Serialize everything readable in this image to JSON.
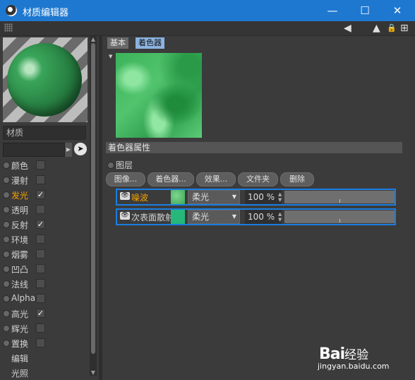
{
  "window": {
    "title": "材质编辑器",
    "minimize": "—",
    "maximize": "☐",
    "close": "✕"
  },
  "toolbar": {
    "icons": [
      "back-arrow-icon",
      "navigate-icon",
      "lock-icon",
      "new-window-icon"
    ],
    "back": "◀",
    "navigate": "▲",
    "lock": "🔒",
    "newwin": "⊞"
  },
  "left": {
    "material_name": "材质",
    "channels": [
      {
        "label": "颜色",
        "checked": false,
        "active": false
      },
      {
        "label": "漫射",
        "checked": false,
        "active": false
      },
      {
        "label": "发光",
        "checked": true,
        "active": true
      },
      {
        "label": "透明",
        "checked": false,
        "active": false
      },
      {
        "label": "反射",
        "checked": true,
        "active": false
      },
      {
        "label": "环境",
        "checked": false,
        "active": false
      },
      {
        "label": "烟雾",
        "checked": false,
        "active": false
      },
      {
        "label": "凹凸",
        "checked": false,
        "active": false
      },
      {
        "label": "法线",
        "checked": false,
        "active": false
      },
      {
        "label": "Alpha",
        "checked": false,
        "active": false
      },
      {
        "label": "高光",
        "checked": true,
        "active": false
      },
      {
        "label": "辉光",
        "checked": false,
        "active": false
      },
      {
        "label": "置换",
        "checked": false,
        "active": false
      }
    ],
    "extra": [
      "编辑",
      "光照"
    ]
  },
  "tabs": [
    "基本",
    "着色器"
  ],
  "section": {
    "title": "着色器属性",
    "layer_label": "图层"
  },
  "buttons": [
    "图像...",
    "着色器...",
    "效果...",
    "文件夹",
    "删除"
  ],
  "layers": [
    {
      "name": "噪波",
      "mode": "柔光",
      "percent": "100 %",
      "active": true,
      "color": "#3aa955"
    },
    {
      "name": "次表面散射",
      "mode": "柔光",
      "percent": "100 %",
      "active": false,
      "color": "#25b87a"
    }
  ],
  "watermark": {
    "brand": "Bai",
    "brand2": "经验",
    "url": "jingyan.baidu.com"
  }
}
